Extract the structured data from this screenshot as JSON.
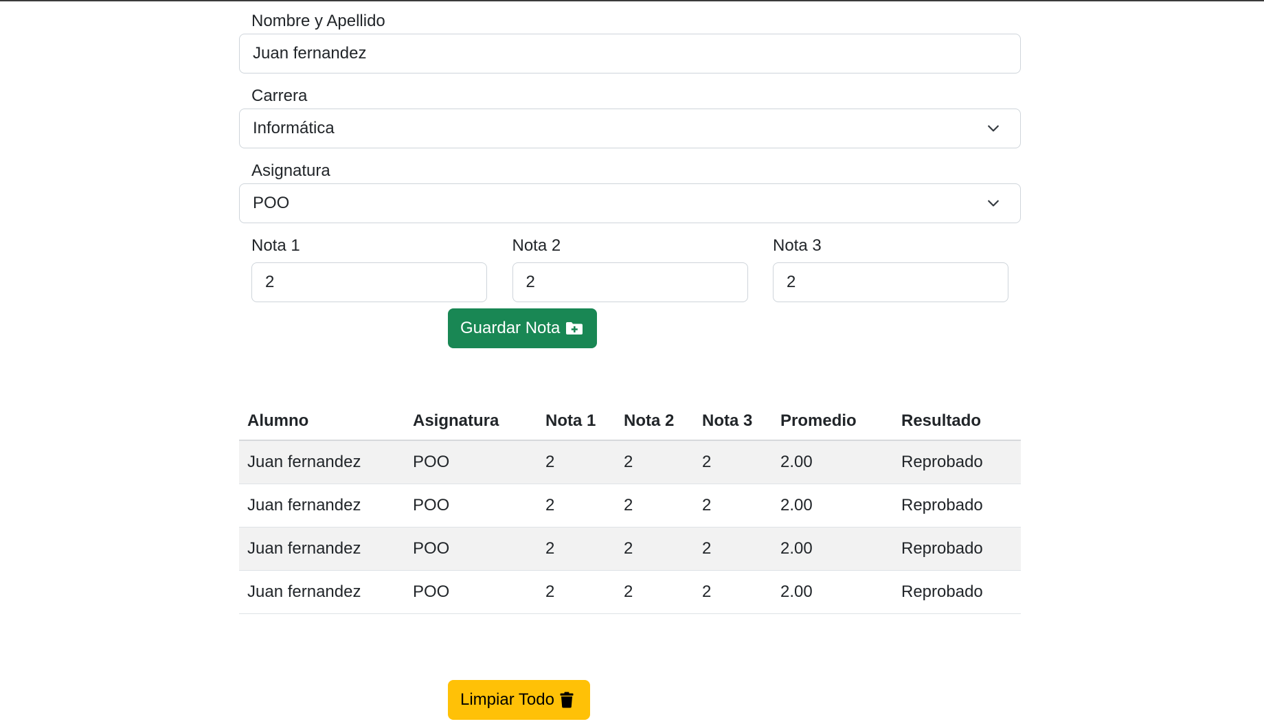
{
  "form": {
    "name_label": "Nombre y Apellido",
    "name_value": "Juan fernandez",
    "carrera_label": "Carrera",
    "carrera_value": "Informática",
    "asignatura_label": "Asignatura",
    "asignatura_value": "POO",
    "nota1_label": "Nota 1",
    "nota1_value": "2",
    "nota2_label": "Nota 2",
    "nota2_value": "2",
    "nota3_label": "Nota 3",
    "nota3_value": "2",
    "save_button_label": "Guardar Nota",
    "save_button_icon": "folder-plus-icon"
  },
  "table": {
    "headers": [
      "Alumno",
      "Asignatura",
      "Nota 1",
      "Nota 2",
      "Nota 3",
      "Promedio",
      "Resultado"
    ],
    "rows": [
      [
        "Juan fernandez",
        "POO",
        "2",
        "2",
        "2",
        "2.00",
        "Reprobado"
      ],
      [
        "Juan fernandez",
        "POO",
        "2",
        "2",
        "2",
        "2.00",
        "Reprobado"
      ],
      [
        "Juan fernandez",
        "POO",
        "2",
        "2",
        "2",
        "2.00",
        "Reprobado"
      ],
      [
        "Juan fernandez",
        "POO",
        "2",
        "2",
        "2",
        "2.00",
        "Reprobado"
      ]
    ]
  },
  "clear_button_label": "Limpiar Todo",
  "clear_button_icon": "trash-icon",
  "colors": {
    "success": "#198754",
    "warning": "#ffc107",
    "striped_row": "#f2f2f2"
  }
}
